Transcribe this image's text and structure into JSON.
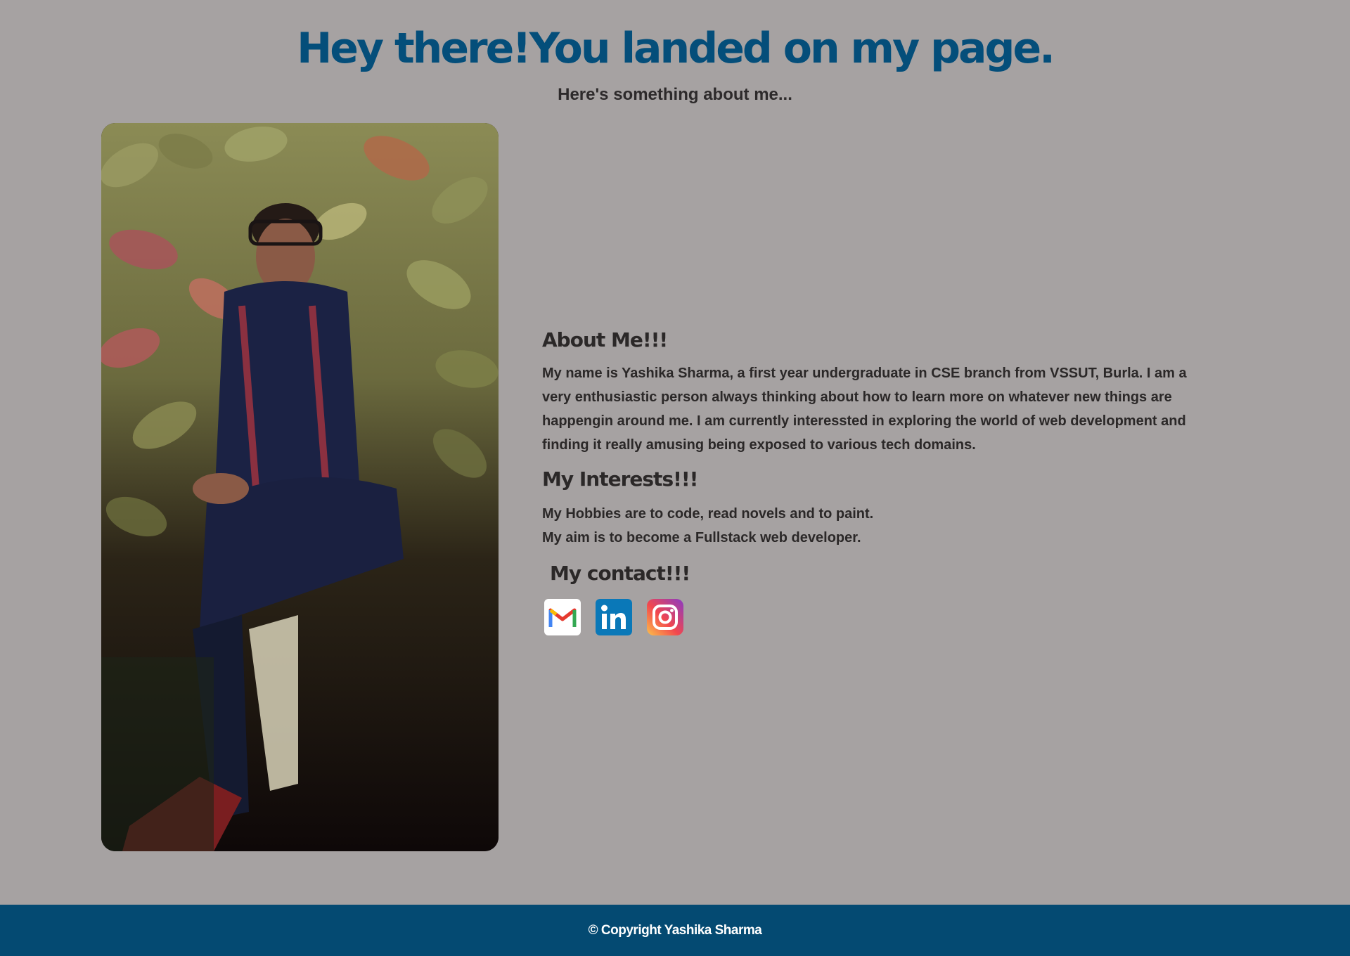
{
  "header": {
    "title": "Hey there!You landed on my page.",
    "subtitle": "Here's something about me..."
  },
  "about": {
    "heading": "About Me!!!",
    "text": "My name is Yashika Sharma, a first year undergraduate in CSE branch from VSSUT, Burla. I am a very enthusiastic person always thinking about how to learn more on whatever new things are happengin around me. I am currently interessted in exploring the world of web development and finding it really amusing being exposed to various tech domains."
  },
  "interests": {
    "heading": "My Interests!!!",
    "line1": "My Hobbies are to code, read novels and to paint.",
    "line2": "My aim is to become a Fullstack web developer."
  },
  "contact": {
    "heading": "My contact!!!",
    "icons": [
      "gmail-icon",
      "linkedin-icon",
      "instagram-icon"
    ]
  },
  "footer": {
    "copyright": "© Copyright Yashika Sharma"
  },
  "colors": {
    "background": "#a6a2a2",
    "title": "#044e7a",
    "footer": "#044a72",
    "text": "#2b2828"
  }
}
